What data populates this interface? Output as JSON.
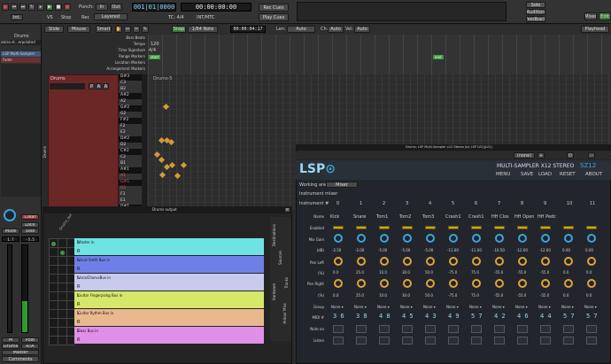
{
  "transport": {
    "punch": "Punch:",
    "in": "In",
    "out": "Out",
    "in2": "Int.",
    "vs": "VS",
    "stop": "Stop",
    "rec": "Rec",
    "rec_mode": "Layered",
    "bbt": "001|01|0000",
    "timecode": "00:00:00:00",
    "tc_tempo": "TC: 4/4",
    "intmtc": "INT/MTC",
    "play_cues": "Play Cues",
    "rec_cues": "Rec Cues",
    "solo": "Solo",
    "audition": "Audition",
    "feedback": "Feedback",
    "mixer": "Mixer",
    "prefs": "Pref",
    "edit": "Edit"
  },
  "toolbar": {
    "slide": "Slide",
    "mouse": "Mouse",
    "smart": "Smart",
    "snap": "Snap",
    "grid": "1/64 Note",
    "nudge_clock": "00:00:04:17",
    "len": "Len:",
    "len_val": "Auto",
    "ch": "Ch:",
    "ch_val": "Auto",
    "vel": "Vel:",
    "vel_val": "Auto",
    "playhead": "Playhead"
  },
  "left_panel": {
    "track": "Drums",
    "plugins": [
      "LSP Multi-Sampler",
      "Fader"
    ],
    "ab": "ab/sa st...erpolated",
    "gain": "-5.5",
    "vol": "1.7",
    "buttons": [
      "Mute",
      "Solo",
      "Lock",
      "Clear"
    ],
    "bottom": [
      "M",
      "Post",
      "Drums",
      "RTA",
      "Master",
      "Comments"
    ],
    "track_label": "Drums"
  },
  "rulers": [
    "Bars:Beats",
    "Tempo",
    "Time Signature",
    "Range Markers",
    "Location Markers",
    "Arrangement Markers"
  ],
  "ruler_values": {
    "tempo": "120",
    "meter": "4/4",
    "start": "start",
    "end": "end"
  },
  "keys": [
    "D#3",
    "C3",
    "B2",
    "A#2",
    "A2",
    "G#2",
    "G2",
    "F#2",
    "F2",
    "E2",
    "D#2",
    "D2",
    "C#2",
    "C2",
    "B1",
    "A#1",
    "A1",
    "G#1",
    "G1",
    "F1",
    "E1",
    "D#1"
  ],
  "region": {
    "name": "Drums",
    "clip": "Drums-5"
  },
  "plugin": {
    "title": "Drums: LSP Multi-Sampler x12 Stereo (by LSP LV2)[LV2]",
    "preset": "(none)",
    "name": "MULTI-SAMPLER X12 STEREO",
    "code": "SZ12",
    "menu": "MENU",
    "save": "SAVE",
    "load": "LOAD",
    "reset": "RESET",
    "about": "ABOUT",
    "working_area": "Working area",
    "area_val": "Mixer",
    "section": "Instrument mixer",
    "inst_label": "Instrument #",
    "row_labels": [
      "Name",
      "Enabled",
      "Mix Gain",
      "(dB)",
      "Pan Left",
      "(%)",
      "Pan Right",
      "(%)",
      "Group",
      "MIDI #",
      "Note on",
      "Listen"
    ],
    "channels": [
      {
        "n": "0",
        "name": "Kick",
        "gain": "-2.50",
        "pl": "0.0",
        "pr": "0.0",
        "group": "None",
        "midi": "3 6"
      },
      {
        "n": "1",
        "name": "Snare",
        "gain": "-2.00",
        "pl": "25.0",
        "pr": "25.0",
        "group": "None",
        "midi": "3 8"
      },
      {
        "n": "2",
        "name": "Tom1",
        "gain": "-5.00",
        "pl": "10.0",
        "pr": "10.0",
        "group": "None",
        "midi": "4 8"
      },
      {
        "n": "3",
        "name": "Tom2",
        "gain": "-5.00",
        "pl": "30.0",
        "pr": "30.0",
        "group": "None",
        "midi": "4 5"
      },
      {
        "n": "4",
        "name": "Tom3",
        "gain": "-5.00",
        "pl": "50.0",
        "pr": "50.0",
        "group": "None",
        "midi": "4 3"
      },
      {
        "n": "5",
        "name": "Crash1",
        "gain": "-11.00",
        "pl": "-75.0",
        "pr": "-75.0",
        "group": "None",
        "midi": "4 9"
      },
      {
        "n": "6",
        "name": "Crash1",
        "gain": "-11.00",
        "pl": "75.0",
        "pr": "75.0",
        "group": "None",
        "midi": "5 7"
      },
      {
        "n": "7",
        "name": "HH Clos",
        "gain": "-10.50",
        "pl": "-55.0",
        "pr": "-55.0",
        "group": "None",
        "midi": "4 2"
      },
      {
        "n": "8",
        "name": "HH Open",
        "gain": "-12.00",
        "pl": "-55.0",
        "pr": "-55.0",
        "group": "None",
        "midi": "4 6"
      },
      {
        "n": "9",
        "name": "HH Pedc",
        "gain": "-12.00",
        "pl": "-55.0",
        "pr": "-55.0",
        "group": "None",
        "midi": "4 4"
      },
      {
        "n": "10",
        "name": "",
        "gain": "0.00",
        "pl": "0.0",
        "pr": "0.0",
        "group": "None",
        "midi": "5 7"
      },
      {
        "n": "11",
        "name": "",
        "gain": "0.00",
        "pl": "0.0",
        "pr": "0.0",
        "group": "None",
        "midi": "5 7"
      }
    ]
  },
  "output_window": {
    "title": "Drums output",
    "corner": "Drums_out",
    "tabs": [
      "Destinations",
      "Sources",
      "Tracks",
      "Hardware",
      "Ardour Misc"
    ],
    "buses": [
      {
        "name": "Master in",
        "color": "#6fe3e3"
      },
      {
        "name": "Vocal Smth Bus in",
        "color": "#6f7fe8"
      },
      {
        "name": "VocalChorusBus in",
        "color": "#c9c9ec"
      },
      {
        "name": "Guitar Fingerpickg Bus in",
        "color": "#d6e86a"
      },
      {
        "name": "Guitar Rythm Bus in",
        "color": "#e8b88f"
      },
      {
        "name": "Bass Bus in",
        "color": "#e08fe6"
      }
    ],
    "ch": [
      "L",
      "R"
    ]
  }
}
